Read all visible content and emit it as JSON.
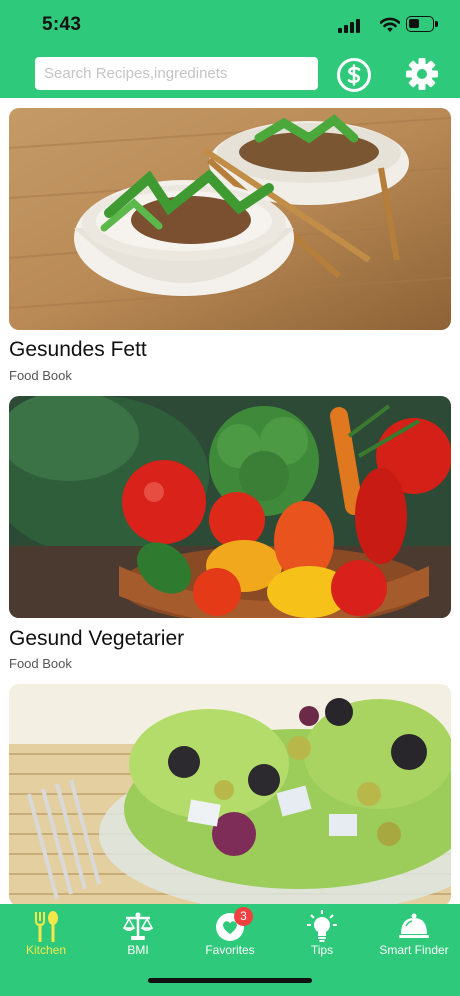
{
  "status_bar": {
    "time": "5:43"
  },
  "search": {
    "placeholder": "Search Recipes,ingredinets"
  },
  "recipes": [
    {
      "title": "Gesundes Fett",
      "source": "Food Book"
    },
    {
      "title": "Gesund Vegetarier",
      "source": "Food Book"
    },
    {
      "title": "",
      "source": ""
    }
  ],
  "tabs": [
    {
      "label": "Kitchen",
      "icon": "fork-spoon-icon",
      "active": true
    },
    {
      "label": "BMI",
      "icon": "scale-icon",
      "active": false
    },
    {
      "label": "Favorites",
      "icon": "heart-icon",
      "active": false,
      "badge": "3"
    },
    {
      "label": "Tips",
      "icon": "lightbulb-icon",
      "active": false
    },
    {
      "label": "Smart Finder",
      "icon": "cloche-icon",
      "active": false
    }
  ],
  "colors": {
    "brand": "#2ec97a",
    "active_tab": "#f5e84a",
    "badge": "#f04040"
  }
}
